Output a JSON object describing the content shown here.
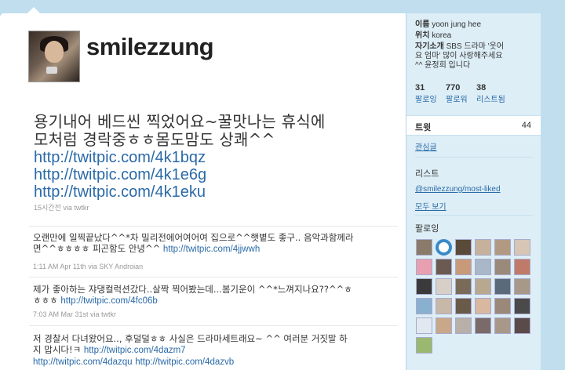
{
  "profile": {
    "username": "smilezzung",
    "avatar_icon": "user-avatar-photo"
  },
  "featured_tweet": {
    "text": "용기내어 베드씬 찍었어요~꿀맛나는 휴식에 모처럼 경락중ㅎㅎ몸도맘도 상쾌^^",
    "links": [
      "http://twitpic.com/4k1bqz",
      "http://twitpic.com/4k1e6g",
      "http://twitpic.com/4k1eku"
    ],
    "meta": "15시간전 via twtkr"
  },
  "tweets": [
    {
      "text": "오랜만에 일찍끝났다^^*차 밀리전에어여어여 집으로^^햇볕도 좋구.. 음악과함께라면^^ㅎㅎㅎㅎ 피곤함도 안녕^^",
      "link": "http://twitpic.com/4jjwwh",
      "meta": "1:11 AM Apr 11th via SKY Androian"
    },
    {
      "text": "제가 좋아하는 쟈댕컬럭션갔다..살짝 찍어봤는데...봄기운이 ^^*느껴지나요??^^ㅎㅎㅎㅎ",
      "link": "http://twitpic.com/4fc06b",
      "meta": "7:03 AM Mar 31st via twtkr"
    },
    {
      "text": "저 경찰서 다녀왔어요.., 후덜덜ㅎㅎ 사실은 드라마세트래요~ ^^ 여러분 거짓말 하지 맙시다!ㅋ",
      "links": [
        "http://twitpic.com/4dazm7",
        "http://twitpic.com/4dazqu",
        "http://twitpic.com/4dazvb"
      ]
    }
  ],
  "sidebar": {
    "name_label": "이름",
    "name_value": "yoon jung hee",
    "location_label": "위치",
    "location_value": "korea",
    "bio_label": "자기소개",
    "bio_value": "SBS 드라마 '웃어요 엄마' 많이 사랑해주세요^^ 윤정희 입니다",
    "stats": [
      {
        "count": "31",
        "label": "팔로잉"
      },
      {
        "count": "770",
        "label": "팔로워"
      },
      {
        "count": "38",
        "label": "리스트됨"
      }
    ],
    "tweets_label": "트윗",
    "tweets_count": "44",
    "favorites_label": "관심글",
    "lists_heading": "리스트",
    "list_link": "@smilezzung/most-liked",
    "view_all": "모두 보기",
    "following_heading": "팔로잉"
  },
  "colors": {
    "background": "#c0deed",
    "link": "#2a6aa8",
    "sidebar": "#ddeef6"
  }
}
